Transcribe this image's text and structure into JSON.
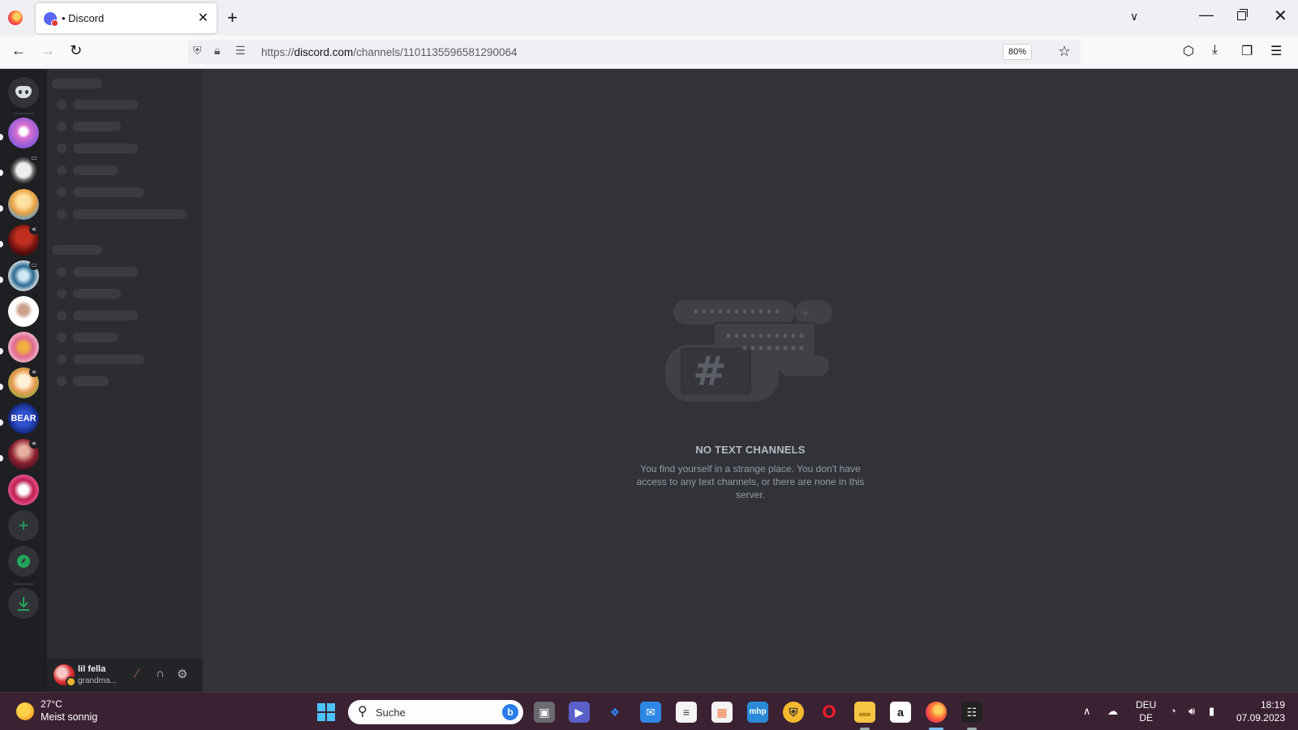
{
  "browser": {
    "tab_title": "• Discord",
    "tab_close": "✕",
    "new_tab": "+",
    "url_prefix": "https://",
    "url_domain": "discord.com",
    "url_path": "/channels/1101135596581290064",
    "zoom": "80%",
    "icons": [
      "firefox-logo",
      "back-arrow",
      "forward-arrow",
      "reload",
      "shield",
      "lock",
      "permissions",
      "star",
      "pocket",
      "download",
      "extensions",
      "menu"
    ]
  },
  "discord": {
    "guild_badges": [
      "speaker",
      "screen",
      "speaker",
      "screen",
      "speaker",
      "speaker"
    ],
    "bear_label": "BEAR",
    "add_server": "+",
    "empty_state": {
      "title": "NO TEXT CHANNELS",
      "description": "You find yourself in a strange place. You don't have access to any text channels, or there are none in this server."
    },
    "user": {
      "name": "lil fella",
      "status": "grandma..."
    },
    "colors": {
      "guild_bg": "#1e1f22",
      "channels_bg": "#2b2d31",
      "main_bg": "#313338",
      "accent_green": "#23a55a",
      "blurple": "#5865f2"
    }
  },
  "taskbar": {
    "weather_temp": "27°C",
    "weather_desc": "Meist sonnig",
    "search_placeholder": "Suche",
    "lang_line1": "DEU",
    "lang_line2": "DE",
    "time": "18:19",
    "date": "07.09.2023",
    "apps": [
      "file-explorer-dark",
      "teams",
      "dropbox",
      "mail",
      "notepad",
      "store",
      "mhp",
      "shield-app",
      "opera",
      "files",
      "amazon",
      "firefox",
      "game"
    ]
  }
}
